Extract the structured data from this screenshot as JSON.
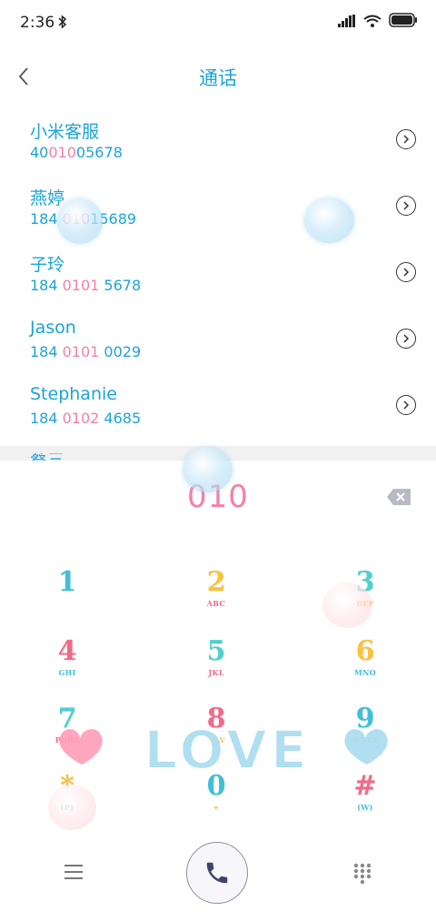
{
  "status": {
    "time": "2:36",
    "icons": [
      "bluetooth-icon",
      "signal-icon",
      "wifi-icon",
      "battery-icon"
    ]
  },
  "header": {
    "title": "通话",
    "back_icon": "chevron-left-icon"
  },
  "contacts": [
    {
      "name": "小米客服",
      "number_pre": "40",
      "number_hl": "010",
      "number_post": "05678"
    },
    {
      "name": "燕婷",
      "number_pre": "184 ",
      "number_hl": "010",
      "number_post": "15689"
    },
    {
      "name": "子玲",
      "number_pre": "184 ",
      "number_hl": "0101",
      "number_post": " 5678"
    },
    {
      "name": "Jason",
      "number_pre": "184 ",
      "number_hl": "0101",
      "number_post": " 0029"
    },
    {
      "name": "Stephanie",
      "number_pre": "184 ",
      "number_hl": "0102",
      "number_post": " 4685"
    }
  ],
  "partial_contact_name": "蔡三",
  "dialer": {
    "dialed_number": "010"
  },
  "keypad": [
    {
      "digit": "1",
      "letters": "",
      "digit_color": "#3fc0d6",
      "letters_color": "#3fc0d6"
    },
    {
      "digit": "2",
      "letters": "ABC",
      "digit_color": "#f9c33b",
      "letters_color": "#f06a8a"
    },
    {
      "digit": "3",
      "letters": "DEF",
      "digit_color": "#4fcfd0",
      "letters_color": "#f9c33b"
    },
    {
      "digit": "4",
      "letters": "GHI",
      "digit_color": "#f06a8a",
      "letters_color": "#3fc0d6"
    },
    {
      "digit": "5",
      "letters": "JKL",
      "digit_color": "#4fcfd0",
      "letters_color": "#f06a8a"
    },
    {
      "digit": "6",
      "letters": "MNO",
      "digit_color": "#f9c33b",
      "letters_color": "#3fc0d6"
    },
    {
      "digit": "7",
      "letters": "PQRS",
      "digit_color": "#4fcfd0",
      "letters_color": "#f06a8a"
    },
    {
      "digit": "8",
      "letters": "TUV",
      "digit_color": "#f06a8a",
      "letters_color": "#f9c33b"
    },
    {
      "digit": "9",
      "letters": "WXYZ",
      "digit_color": "#3fc0d6",
      "letters_color": "#f9c33b"
    },
    {
      "digit": "*",
      "letters": "(P)",
      "digit_color": "#f9c33b",
      "letters_color": "#3fc0d6"
    },
    {
      "digit": "0",
      "letters": "+",
      "digit_color": "#3fc0d6",
      "letters_color": "#f9c33b"
    },
    {
      "digit": "#",
      "letters": "(W)",
      "digit_color": "#f06a8a",
      "letters_color": "#3fc0d6"
    }
  ],
  "love_text": "LOVE",
  "colors": {
    "accent_blue": "#1ba4d8",
    "accent_pink": "#f480a5"
  },
  "bottom_bar": {
    "menu_icon": "menu-icon",
    "call_icon": "phone-icon",
    "keypad_icon": "dialpad-icon"
  }
}
